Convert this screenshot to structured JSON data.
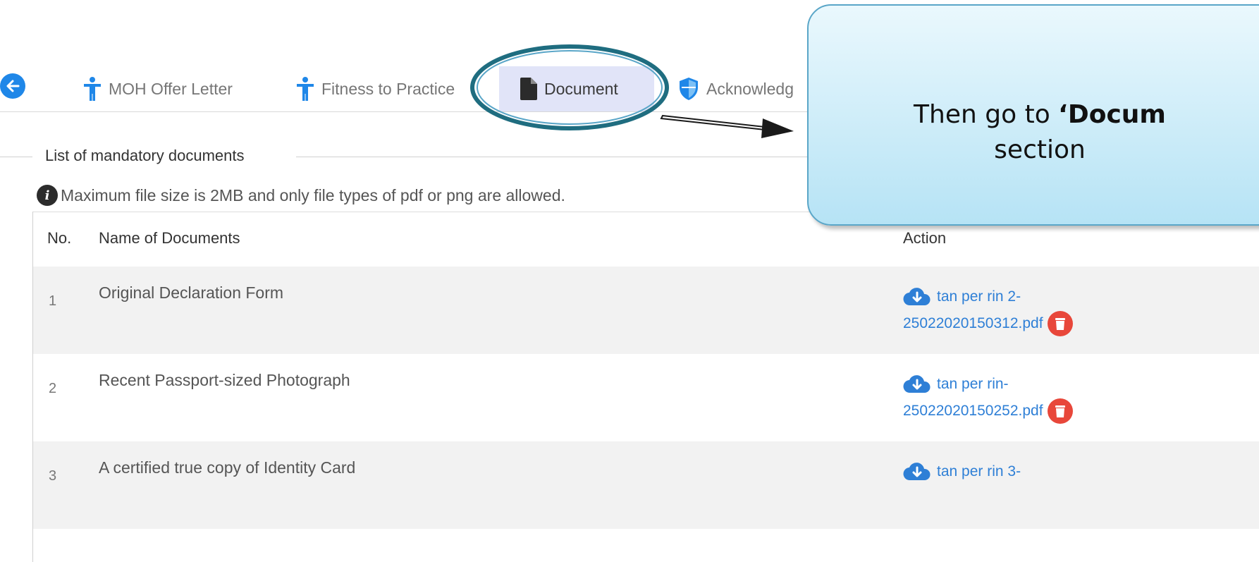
{
  "tabs": [
    {
      "label": "MOH Offer Letter",
      "icon": "person-icon"
    },
    {
      "label": "Fitness to Practice",
      "icon": "person-icon"
    },
    {
      "label": "Document",
      "icon": "document-icon",
      "active": true
    },
    {
      "label": "Acknowledg",
      "icon": "shield-icon"
    }
  ],
  "section": {
    "legend": "List of mandatory documents",
    "info": "Maximum file size is 2MB and only file types of pdf or png are allowed."
  },
  "table": {
    "headers": {
      "no": "No.",
      "name": "Name of Documents",
      "action": "Action"
    },
    "rows": [
      {
        "no": "1",
        "name": "Original Declaration Form",
        "file_line1": "tan per rin 2-",
        "file_line2": "25022020150312.pdf"
      },
      {
        "no": "2",
        "name": "Recent Passport-sized Photograph",
        "file_line1": "tan per rin-",
        "file_line2": "25022020150252.pdf"
      },
      {
        "no": "3",
        "name": "A certified true copy of Identity Card",
        "file_line1": "tan per rin 3-",
        "file_line2": ""
      }
    ]
  },
  "callout": {
    "text_before": "Then go to ",
    "text_bold": "‘Docum",
    "text_line2": "section"
  },
  "colors": {
    "accent": "#1f87e8",
    "link": "#2e7fd6",
    "delete": "#e8473a",
    "active_tab_bg": "#e1e4f8",
    "annotation_ring": "#1f6d80"
  }
}
